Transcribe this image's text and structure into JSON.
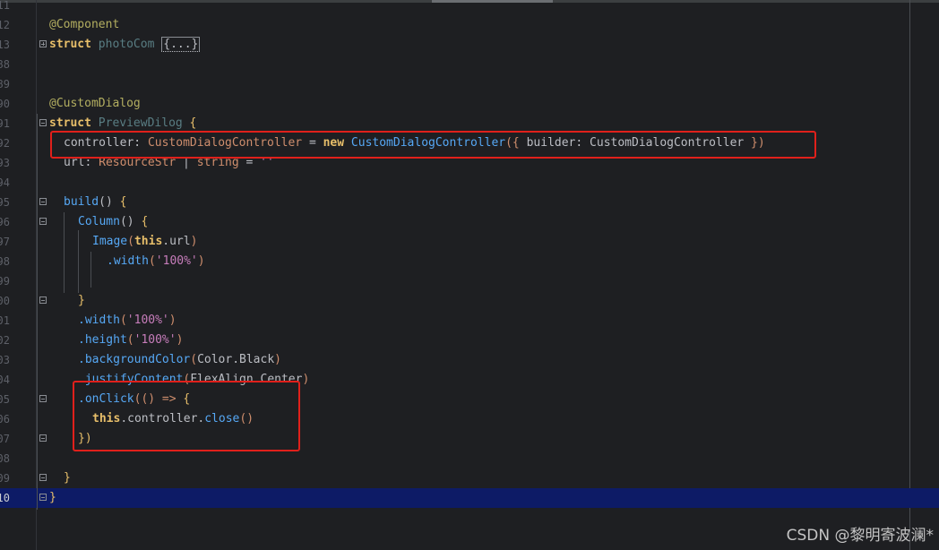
{
  "lines": [
    {
      "num": "11",
      "fold": "",
      "indent": 0,
      "tokens": []
    },
    {
      "num": "12",
      "fold": "",
      "indent": 0,
      "tokens": [
        {
          "t": "@Component",
          "c": "dec"
        }
      ]
    },
    {
      "num": "13",
      "fold": "plus",
      "indent": 0,
      "tokens": [
        {
          "t": "struct ",
          "c": "kw"
        },
        {
          "t": "photoCom ",
          "c": "struct"
        },
        {
          "t": "{...}",
          "c": "collapsed"
        }
      ]
    },
    {
      "num": "88",
      "fold": "",
      "indent": 0,
      "tokens": []
    },
    {
      "num": "89",
      "fold": "",
      "indent": 0,
      "tokens": []
    },
    {
      "num": "90",
      "fold": "",
      "indent": 0,
      "tokens": [
        {
          "t": "@CustomDialog",
          "c": "dec"
        }
      ]
    },
    {
      "num": "91",
      "fold": "minus",
      "indent": 0,
      "tokens": [
        {
          "t": "struct ",
          "c": "kw"
        },
        {
          "t": "PreviewDilog ",
          "c": "struct"
        },
        {
          "t": "{",
          "c": "br"
        }
      ]
    },
    {
      "num": "92",
      "fold": "",
      "indent": 2,
      "tokens": [
        {
          "t": "controller",
          "c": "plain"
        },
        {
          "t": ": ",
          "c": "plain"
        },
        {
          "t": "CustomDialogController",
          "c": "type"
        },
        {
          "t": " = ",
          "c": "plain"
        },
        {
          "t": "new ",
          "c": "kw"
        },
        {
          "t": "CustomDialogController",
          "c": "fn"
        },
        {
          "t": "({ ",
          "c": "type"
        },
        {
          "t": "builder",
          "c": "plain"
        },
        {
          "t": ": ",
          "c": "plain"
        },
        {
          "t": "CustomDialogController",
          "c": "plain"
        },
        {
          "t": " })",
          "c": "type"
        }
      ]
    },
    {
      "num": "93",
      "fold": "",
      "indent": 2,
      "tokens": [
        {
          "t": "url",
          "c": "plain"
        },
        {
          "t": ": ",
          "c": "plain"
        },
        {
          "t": "ResourceStr",
          "c": "type"
        },
        {
          "t": " | ",
          "c": "plain"
        },
        {
          "t": "string",
          "c": "type"
        },
        {
          "t": " = ",
          "c": "plain"
        },
        {
          "t": "''",
          "c": "str"
        }
      ]
    },
    {
      "num": "94",
      "fold": "",
      "indent": 0,
      "tokens": []
    },
    {
      "num": "95",
      "fold": "minus",
      "indent": 2,
      "tokens": [
        {
          "t": "build",
          "c": "fn"
        },
        {
          "t": "() ",
          "c": "plain"
        },
        {
          "t": "{",
          "c": "br"
        }
      ]
    },
    {
      "num": "96",
      "fold": "minus",
      "indent": 4,
      "tokens": [
        {
          "t": "Column",
          "c": "fn"
        },
        {
          "t": "() ",
          "c": "plain"
        },
        {
          "t": "{",
          "c": "br"
        }
      ]
    },
    {
      "num": "97",
      "fold": "",
      "indent": 6,
      "tokens": [
        {
          "t": "Image",
          "c": "fn"
        },
        {
          "t": "(",
          "c": "type"
        },
        {
          "t": "this",
          "c": "kw"
        },
        {
          "t": ".url",
          "c": "plain"
        },
        {
          "t": ")",
          "c": "type"
        }
      ]
    },
    {
      "num": "98",
      "fold": "",
      "indent": 8,
      "tokens": [
        {
          "t": ".width",
          "c": "fn"
        },
        {
          "t": "(",
          "c": "type"
        },
        {
          "t": "'100%'",
          "c": "str"
        },
        {
          "t": ")",
          "c": "type"
        }
      ]
    },
    {
      "num": "99",
      "fold": "",
      "indent": 0,
      "tokens": []
    },
    {
      "num": "00",
      "fold": "minus",
      "indent": 4,
      "tokens": [
        {
          "t": "}",
          "c": "br"
        }
      ]
    },
    {
      "num": "01",
      "fold": "",
      "indent": 4,
      "tokens": [
        {
          "t": ".width",
          "c": "fn"
        },
        {
          "t": "(",
          "c": "type"
        },
        {
          "t": "'100%'",
          "c": "str"
        },
        {
          "t": ")",
          "c": "type"
        }
      ]
    },
    {
      "num": "02",
      "fold": "",
      "indent": 4,
      "tokens": [
        {
          "t": ".height",
          "c": "fn"
        },
        {
          "t": "(",
          "c": "type"
        },
        {
          "t": "'100%'",
          "c": "str"
        },
        {
          "t": ")",
          "c": "type"
        }
      ]
    },
    {
      "num": "03",
      "fold": "",
      "indent": 4,
      "tokens": [
        {
          "t": ".backgroundColor",
          "c": "fn"
        },
        {
          "t": "(",
          "c": "type"
        },
        {
          "t": "Color.Black",
          "c": "plain"
        },
        {
          "t": ")",
          "c": "type"
        }
      ]
    },
    {
      "num": "04",
      "fold": "",
      "indent": 4,
      "tokens": [
        {
          "t": ".justifyContent",
          "c": "fn"
        },
        {
          "t": "(",
          "c": "type"
        },
        {
          "t": "FlexAlign.Center",
          "c": "plain"
        },
        {
          "t": ")",
          "c": "type"
        }
      ]
    },
    {
      "num": "05",
      "fold": "minus",
      "indent": 4,
      "tokens": [
        {
          "t": ".onClick",
          "c": "fn"
        },
        {
          "t": "(() => ",
          "c": "type"
        },
        {
          "t": "{",
          "c": "br"
        }
      ]
    },
    {
      "num": "06",
      "fold": "",
      "indent": 6,
      "tokens": [
        {
          "t": "this",
          "c": "kw"
        },
        {
          "t": ".controller.",
          "c": "plain"
        },
        {
          "t": "close",
          "c": "fn"
        },
        {
          "t": "()",
          "c": "type"
        }
      ]
    },
    {
      "num": "07",
      "fold": "minus",
      "indent": 4,
      "tokens": [
        {
          "t": "})",
          "c": "br"
        }
      ]
    },
    {
      "num": "08",
      "fold": "",
      "indent": 0,
      "tokens": []
    },
    {
      "num": "09",
      "fold": "minus",
      "indent": 2,
      "tokens": [
        {
          "t": "}",
          "c": "br"
        }
      ]
    },
    {
      "num": "10",
      "fold": "minus",
      "indent": 0,
      "current": true,
      "tokens": [
        {
          "t": "}",
          "c": "br"
        }
      ]
    }
  ],
  "watermark": "CSDN @黎明寄波澜*",
  "colors": {
    "background": "#1e1f22",
    "current_line": "#0d1b66",
    "highlight_box": "#e0201b",
    "keyword": "#e8bf6a",
    "function": "#56a8f5",
    "string": "#c77dbb"
  }
}
